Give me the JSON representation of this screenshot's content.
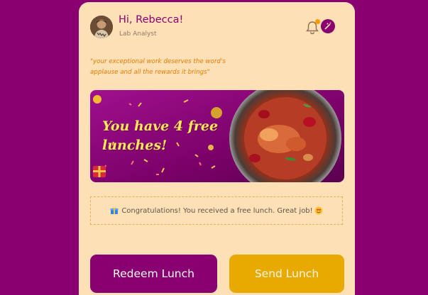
{
  "header": {
    "greeting": "Hi, Rebecca!",
    "role": "Lab Analyst"
  },
  "quote": "\"your exceptional work deserves the word's applause and all the rewards it brings\"",
  "banner": {
    "line1": "You have 4 free",
    "line2": "lunches!"
  },
  "congrats": {
    "message": "Congratulations! You received a free lunch. Great job!"
  },
  "actions": {
    "redeem_label": "Redeem Lunch",
    "send_label": "Send Lunch"
  },
  "colors": {
    "brand": "#8a0070",
    "accent": "#e8a900",
    "card": "#fde0b6",
    "quote": "#e57a00"
  },
  "icons": {
    "notification": "bell-icon",
    "badge": "wand-icon",
    "gift": "gift-icon",
    "emoji": "heart-eyes-icon"
  }
}
